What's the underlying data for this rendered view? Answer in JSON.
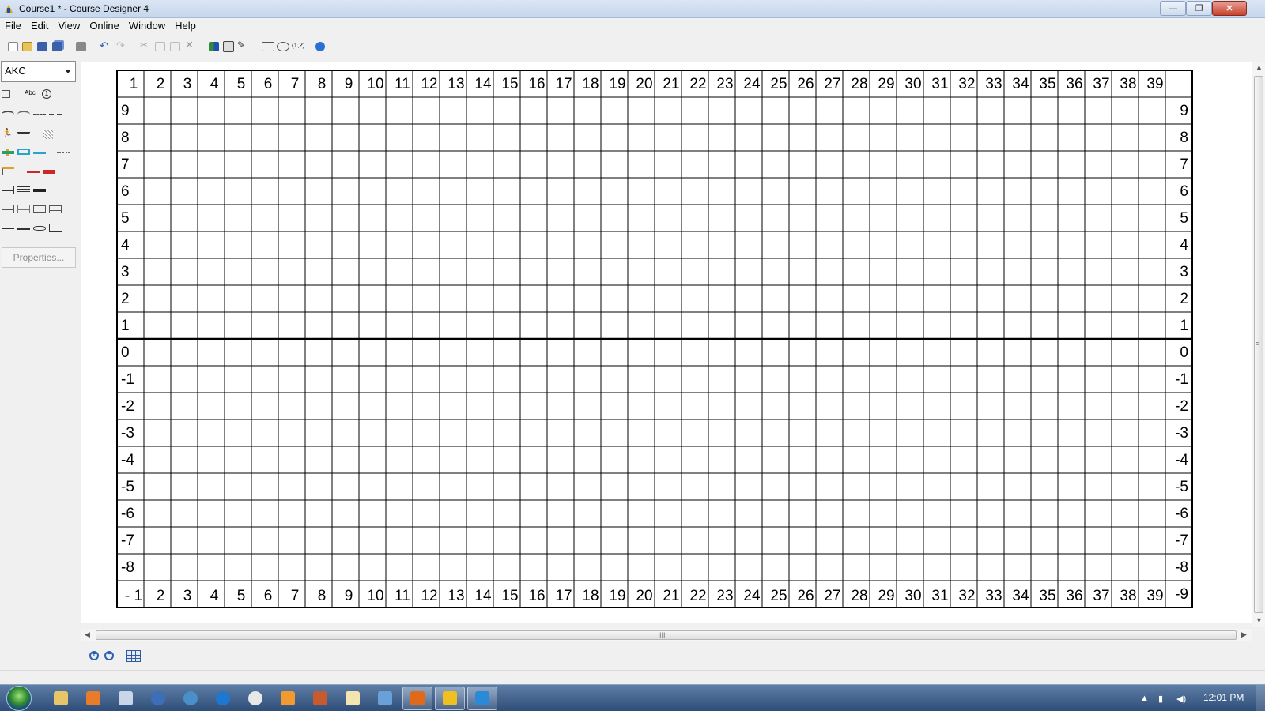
{
  "window": {
    "title": "Course1 * - Course Designer 4",
    "controls": {
      "minimize": "—",
      "restore": "❐",
      "close": "✕"
    }
  },
  "menu": [
    "File",
    "Edit",
    "View",
    "Online",
    "Window",
    "Help"
  ],
  "toolbar": {
    "icons": [
      "new-icon",
      "open-icon",
      "save-icon",
      "save-all-icon",
      "print-icon",
      "undo-icon",
      "redo-icon",
      "cut-icon",
      "copy-icon",
      "paste-icon",
      "delete-icon",
      "ring-color-icon",
      "draw-mode-icon",
      "pencil-icon",
      "obstacle-view-icon",
      "zoom-view-icon",
      "numbering-icon",
      "help-icon"
    ]
  },
  "palette": {
    "breed": "AKC",
    "properties_label": "Properties...",
    "row1_labels": [
      "Abc",
      "1"
    ]
  },
  "grid": {
    "top_labels": [
      "1",
      "2",
      "3",
      "4",
      "5",
      "6",
      "7",
      "8",
      "9",
      "10",
      "11",
      "12",
      "13",
      "14",
      "15",
      "16",
      "17",
      "18",
      "19",
      "20",
      "21",
      "22",
      "23",
      "24",
      "25",
      "26",
      "27",
      "28",
      "29",
      "30",
      "31",
      "32",
      "33",
      "34",
      "35",
      "36",
      "37",
      "38",
      "39"
    ],
    "bottom_labels": [
      "- 1",
      "2",
      "3",
      "4",
      "5",
      "6",
      "7",
      "8",
      "9",
      "10",
      "11",
      "12",
      "13",
      "14",
      "15",
      "16",
      "17",
      "18",
      "19",
      "20",
      "21",
      "22",
      "23",
      "24",
      "25",
      "26",
      "27",
      "28",
      "29",
      "30",
      "31",
      "32",
      "33",
      "34",
      "35",
      "36",
      "37",
      "38",
      "39"
    ],
    "left_labels": [
      "9",
      "8",
      "7",
      "6",
      "5",
      "4",
      "3",
      "2",
      "1",
      "0",
      "-1",
      "-2",
      "-3",
      "-4",
      "-5",
      "-6",
      "-7",
      "-8"
    ],
    "right_labels": [
      "9",
      "8",
      "7",
      "6",
      "5",
      "4",
      "3",
      "2",
      "1",
      "0",
      "-1",
      "-2",
      "-3",
      "-4",
      "-5",
      "-6",
      "-7",
      "-8",
      "-9"
    ]
  },
  "scrollbars": {
    "h_grip": "III",
    "v_grip": "≡"
  },
  "zoom": {
    "in": "+",
    "out": "−"
  },
  "taskbar": {
    "time": "12:01 PM",
    "apps": [
      "explorer-icon",
      "media-player-icon",
      "documents-icon",
      "mail-icon",
      "web-icon",
      "ie-icon",
      "chrome-icon",
      "tool-icon",
      "settings-icon",
      "notes-icon",
      "messenger-icon",
      "firefox-icon",
      "course-designer-icon",
      "snipping-icon"
    ]
  }
}
